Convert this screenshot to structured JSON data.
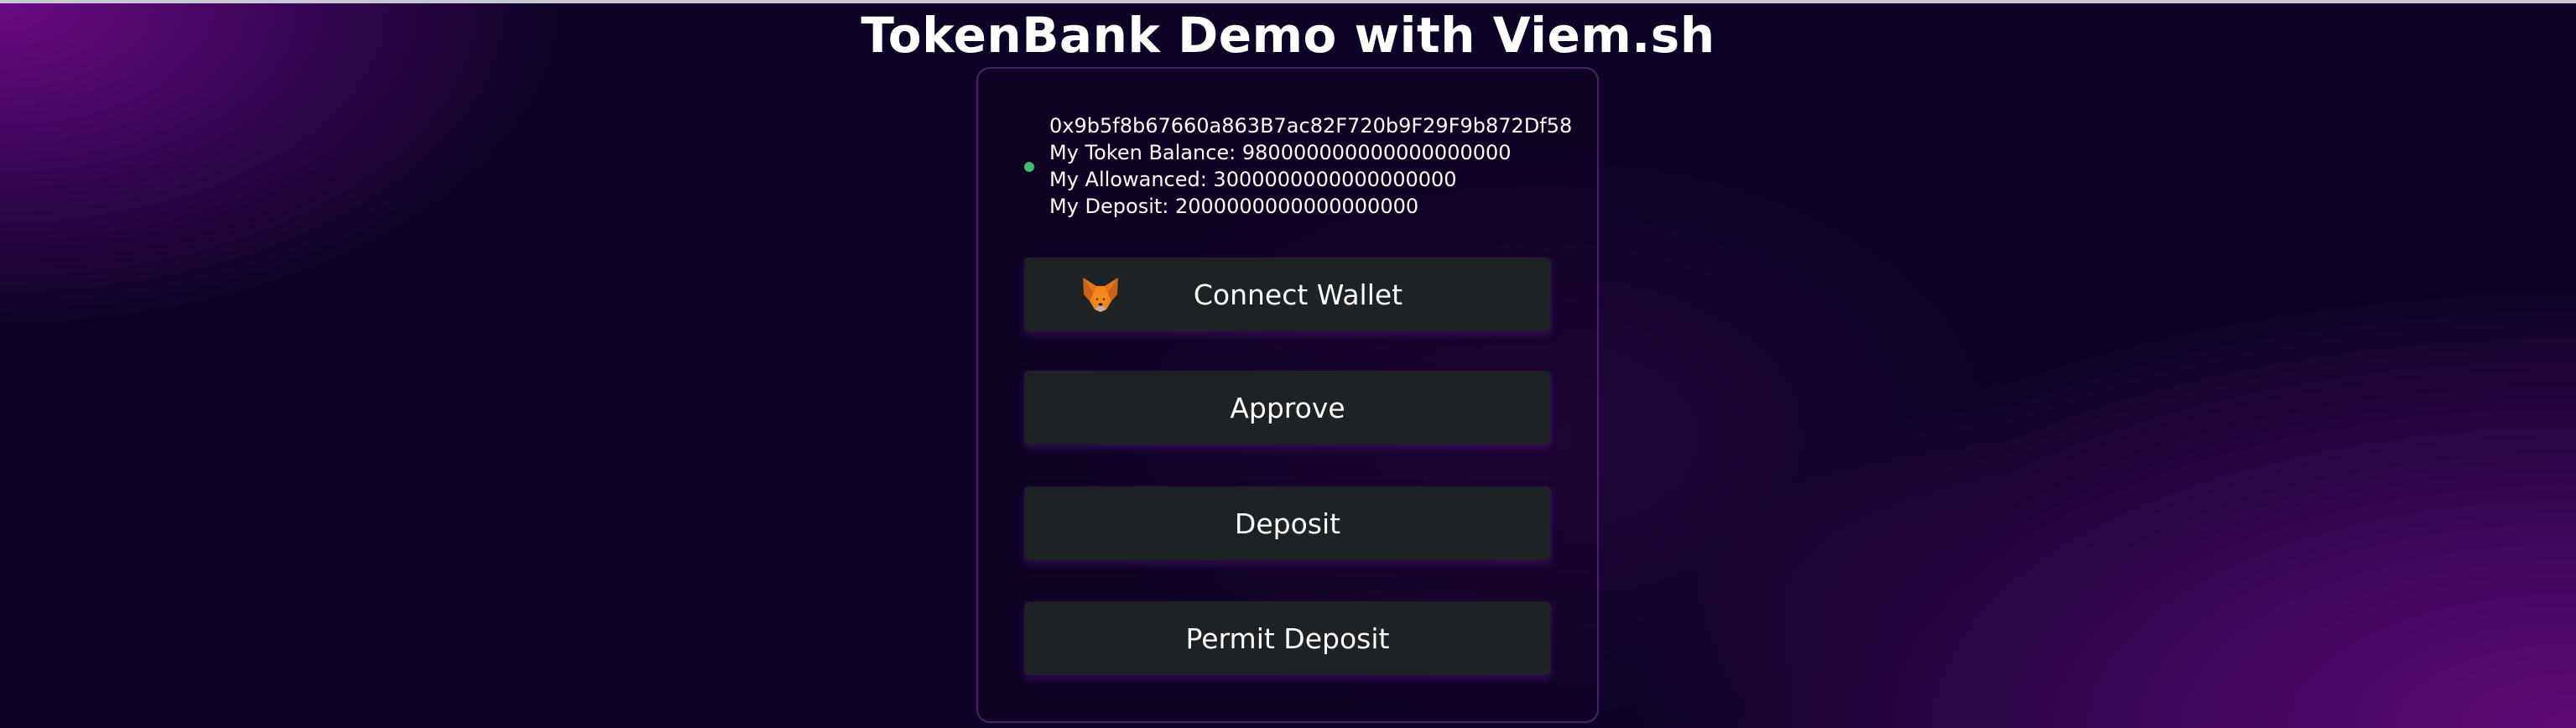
{
  "page": {
    "title": "TokenBank Demo with Viem.sh"
  },
  "wallet": {
    "address": "0x9b5f8b67660a863B7ac82F720b9F29F9b872Df58",
    "token_balance": "My Token Balance: 980000000000000000000",
    "allowance": "My Allowanced: 3000000000000000000",
    "deposit": "My Deposit: 2000000000000000000",
    "connected": true,
    "status_color": "#3fbf6a"
  },
  "buttons": {
    "connect_label": "Connect Wallet",
    "connect_icon": "metamask-fox-icon",
    "approve_label": "Approve",
    "deposit_label": "Deposit",
    "permit_deposit_label": "Permit Deposit"
  },
  "colors": {
    "background_primary": "#0c0326",
    "background_accent": "#6a0a86",
    "button_background": "#1f2224"
  }
}
